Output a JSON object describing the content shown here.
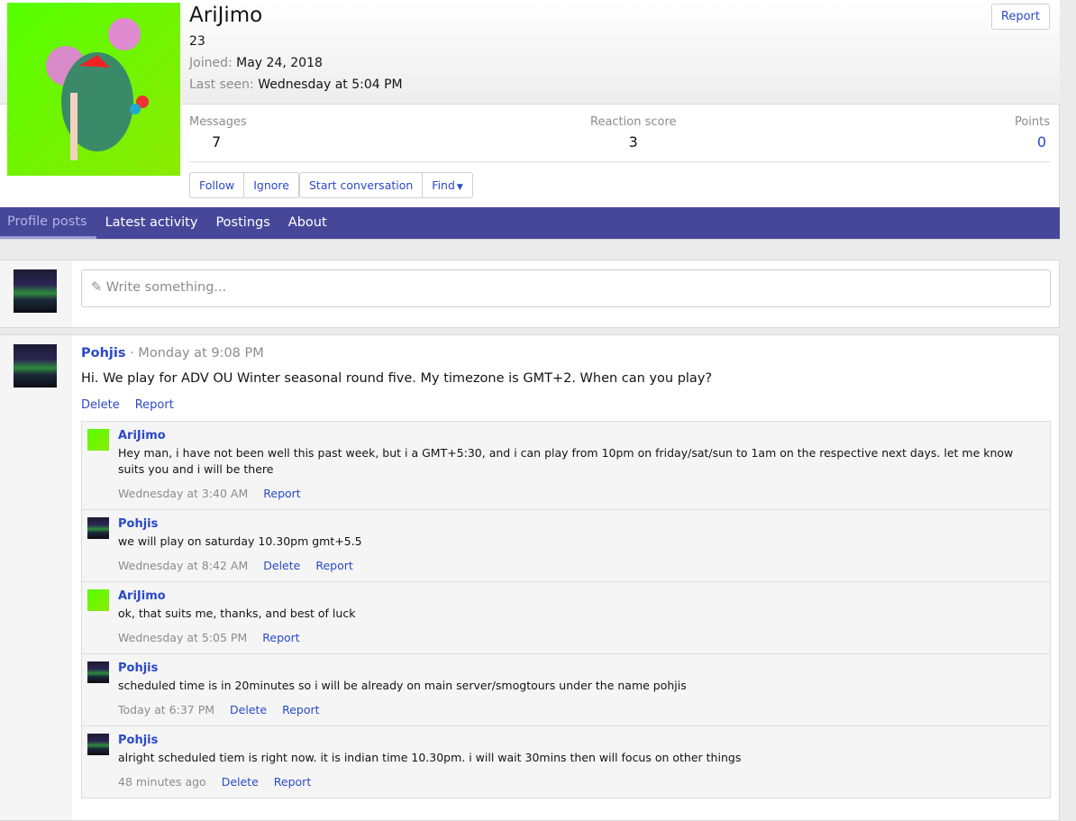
{
  "profile": {
    "username": "AriJimo",
    "title": "23",
    "joined_label": "Joined:",
    "joined": "May 24, 2018",
    "last_seen_label": "Last seen:",
    "last_seen": "Wednesday at 5:04 PM",
    "report": "Report",
    "stats": [
      {
        "label": "Messages",
        "value": "7"
      },
      {
        "label": "Reaction score",
        "value": "3"
      },
      {
        "label": "Points",
        "value": "0"
      }
    ],
    "buttons": {
      "follow": "Follow",
      "ignore": "Ignore",
      "start_conversation": "Start conversation",
      "find": "Find"
    }
  },
  "tabs": [
    "Profile posts",
    "Latest activity",
    "Postings",
    "About"
  ],
  "composer": {
    "placeholder": "Write something..."
  },
  "post": {
    "author": "Pohjis",
    "time": "· Monday at 9:08 PM",
    "text": "Hi. We play for ADV OU Winter seasonal round five. My timezone is GMT+2. When can you play?",
    "delete": "Delete",
    "report": "Report"
  },
  "comments": [
    {
      "author": "AriJimo",
      "text": "Hey man, i have not been well this past week, but i a GMT+5:30, and i can play from 10pm on friday/sat/sun to 1am on the respective next days. let me know suits you and i will be there",
      "time": "Wednesday at 3:40 AM",
      "actions": [
        "Report"
      ],
      "avatar": "green"
    },
    {
      "author": "Pohjis",
      "text": "we will play on saturday 10.30pm gmt+5.5",
      "time": "Wednesday at 8:42 AM",
      "actions": [
        "Delete",
        "Report"
      ],
      "avatar": "aurora"
    },
    {
      "author": "AriJimo",
      "text": "ok, that suits me, thanks, and best of luck",
      "time": "Wednesday at 5:05 PM",
      "actions": [
        "Report"
      ],
      "avatar": "green"
    },
    {
      "author": "Pohjis",
      "text": "scheduled time is in 20minutes so i will be already on main server/smogtours under the name pohjis",
      "time": "Today at 6:37 PM",
      "actions": [
        "Delete",
        "Report"
      ],
      "avatar": "aurora"
    },
    {
      "author": "Pohjis",
      "text": "alright scheduled tiem is right now. it is indian time 10.30pm. i will wait 30mins then will focus on other things",
      "time": "48 minutes ago",
      "actions": [
        "Delete",
        "Report"
      ],
      "avatar": "aurora"
    }
  ]
}
